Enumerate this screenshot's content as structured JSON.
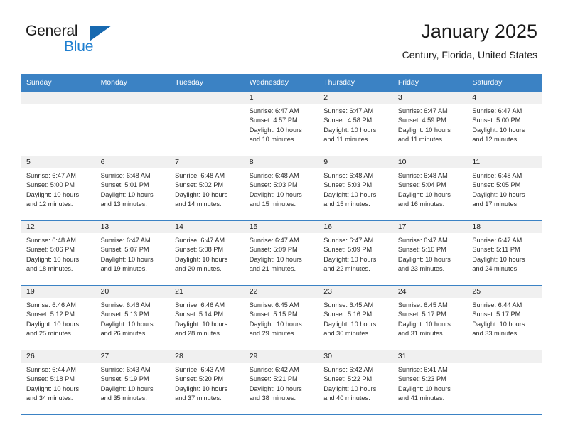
{
  "brand": {
    "name_part1": "General",
    "name_part2": "Blue",
    "triangle_color": "#1769b0",
    "blue_color": "#1f7fd0"
  },
  "header": {
    "month_title": "January 2025",
    "location": "Century, Florida, United States"
  },
  "theme": {
    "header_row_bg": "#3b82c4",
    "daynum_bg": "#f0f0f0",
    "border_color": "#3b82c4",
    "text_color": "#1a1a1a"
  },
  "weekdays": [
    "Sunday",
    "Monday",
    "Tuesday",
    "Wednesday",
    "Thursday",
    "Friday",
    "Saturday"
  ],
  "labels": {
    "sunrise_prefix": "Sunrise: ",
    "sunset_prefix": "Sunset: ",
    "daylight_prefix": "Daylight: "
  },
  "weeks": [
    [
      {
        "day": "",
        "sunrise": "",
        "sunset": "",
        "daylight": ""
      },
      {
        "day": "",
        "sunrise": "",
        "sunset": "",
        "daylight": ""
      },
      {
        "day": "",
        "sunrise": "",
        "sunset": "",
        "daylight": ""
      },
      {
        "day": "1",
        "sunrise": "Sunrise: 6:47 AM",
        "sunset": "Sunset: 4:57 PM",
        "daylight": "Daylight: 10 hours and 10 minutes."
      },
      {
        "day": "2",
        "sunrise": "Sunrise: 6:47 AM",
        "sunset": "Sunset: 4:58 PM",
        "daylight": "Daylight: 10 hours and 11 minutes."
      },
      {
        "day": "3",
        "sunrise": "Sunrise: 6:47 AM",
        "sunset": "Sunset: 4:59 PM",
        "daylight": "Daylight: 10 hours and 11 minutes."
      },
      {
        "day": "4",
        "sunrise": "Sunrise: 6:47 AM",
        "sunset": "Sunset: 5:00 PM",
        "daylight": "Daylight: 10 hours and 12 minutes."
      }
    ],
    [
      {
        "day": "5",
        "sunrise": "Sunrise: 6:47 AM",
        "sunset": "Sunset: 5:00 PM",
        "daylight": "Daylight: 10 hours and 12 minutes."
      },
      {
        "day": "6",
        "sunrise": "Sunrise: 6:48 AM",
        "sunset": "Sunset: 5:01 PM",
        "daylight": "Daylight: 10 hours and 13 minutes."
      },
      {
        "day": "7",
        "sunrise": "Sunrise: 6:48 AM",
        "sunset": "Sunset: 5:02 PM",
        "daylight": "Daylight: 10 hours and 14 minutes."
      },
      {
        "day": "8",
        "sunrise": "Sunrise: 6:48 AM",
        "sunset": "Sunset: 5:03 PM",
        "daylight": "Daylight: 10 hours and 15 minutes."
      },
      {
        "day": "9",
        "sunrise": "Sunrise: 6:48 AM",
        "sunset": "Sunset: 5:03 PM",
        "daylight": "Daylight: 10 hours and 15 minutes."
      },
      {
        "day": "10",
        "sunrise": "Sunrise: 6:48 AM",
        "sunset": "Sunset: 5:04 PM",
        "daylight": "Daylight: 10 hours and 16 minutes."
      },
      {
        "day": "11",
        "sunrise": "Sunrise: 6:48 AM",
        "sunset": "Sunset: 5:05 PM",
        "daylight": "Daylight: 10 hours and 17 minutes."
      }
    ],
    [
      {
        "day": "12",
        "sunrise": "Sunrise: 6:48 AM",
        "sunset": "Sunset: 5:06 PM",
        "daylight": "Daylight: 10 hours and 18 minutes."
      },
      {
        "day": "13",
        "sunrise": "Sunrise: 6:47 AM",
        "sunset": "Sunset: 5:07 PM",
        "daylight": "Daylight: 10 hours and 19 minutes."
      },
      {
        "day": "14",
        "sunrise": "Sunrise: 6:47 AM",
        "sunset": "Sunset: 5:08 PM",
        "daylight": "Daylight: 10 hours and 20 minutes."
      },
      {
        "day": "15",
        "sunrise": "Sunrise: 6:47 AM",
        "sunset": "Sunset: 5:09 PM",
        "daylight": "Daylight: 10 hours and 21 minutes."
      },
      {
        "day": "16",
        "sunrise": "Sunrise: 6:47 AM",
        "sunset": "Sunset: 5:09 PM",
        "daylight": "Daylight: 10 hours and 22 minutes."
      },
      {
        "day": "17",
        "sunrise": "Sunrise: 6:47 AM",
        "sunset": "Sunset: 5:10 PM",
        "daylight": "Daylight: 10 hours and 23 minutes."
      },
      {
        "day": "18",
        "sunrise": "Sunrise: 6:47 AM",
        "sunset": "Sunset: 5:11 PM",
        "daylight": "Daylight: 10 hours and 24 minutes."
      }
    ],
    [
      {
        "day": "19",
        "sunrise": "Sunrise: 6:46 AM",
        "sunset": "Sunset: 5:12 PM",
        "daylight": "Daylight: 10 hours and 25 minutes."
      },
      {
        "day": "20",
        "sunrise": "Sunrise: 6:46 AM",
        "sunset": "Sunset: 5:13 PM",
        "daylight": "Daylight: 10 hours and 26 minutes."
      },
      {
        "day": "21",
        "sunrise": "Sunrise: 6:46 AM",
        "sunset": "Sunset: 5:14 PM",
        "daylight": "Daylight: 10 hours and 28 minutes."
      },
      {
        "day": "22",
        "sunrise": "Sunrise: 6:45 AM",
        "sunset": "Sunset: 5:15 PM",
        "daylight": "Daylight: 10 hours and 29 minutes."
      },
      {
        "day": "23",
        "sunrise": "Sunrise: 6:45 AM",
        "sunset": "Sunset: 5:16 PM",
        "daylight": "Daylight: 10 hours and 30 minutes."
      },
      {
        "day": "24",
        "sunrise": "Sunrise: 6:45 AM",
        "sunset": "Sunset: 5:17 PM",
        "daylight": "Daylight: 10 hours and 31 minutes."
      },
      {
        "day": "25",
        "sunrise": "Sunrise: 6:44 AM",
        "sunset": "Sunset: 5:17 PM",
        "daylight": "Daylight: 10 hours and 33 minutes."
      }
    ],
    [
      {
        "day": "26",
        "sunrise": "Sunrise: 6:44 AM",
        "sunset": "Sunset: 5:18 PM",
        "daylight": "Daylight: 10 hours and 34 minutes."
      },
      {
        "day": "27",
        "sunrise": "Sunrise: 6:43 AM",
        "sunset": "Sunset: 5:19 PM",
        "daylight": "Daylight: 10 hours and 35 minutes."
      },
      {
        "day": "28",
        "sunrise": "Sunrise: 6:43 AM",
        "sunset": "Sunset: 5:20 PM",
        "daylight": "Daylight: 10 hours and 37 minutes."
      },
      {
        "day": "29",
        "sunrise": "Sunrise: 6:42 AM",
        "sunset": "Sunset: 5:21 PM",
        "daylight": "Daylight: 10 hours and 38 minutes."
      },
      {
        "day": "30",
        "sunrise": "Sunrise: 6:42 AM",
        "sunset": "Sunset: 5:22 PM",
        "daylight": "Daylight: 10 hours and 40 minutes."
      },
      {
        "day": "31",
        "sunrise": "Sunrise: 6:41 AM",
        "sunset": "Sunset: 5:23 PM",
        "daylight": "Daylight: 10 hours and 41 minutes."
      },
      {
        "day": "",
        "sunrise": "",
        "sunset": "",
        "daylight": ""
      }
    ]
  ]
}
